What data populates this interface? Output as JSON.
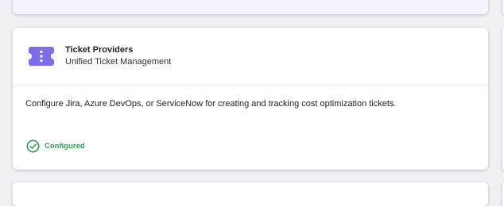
{
  "card": {
    "icon": "ticket-icon",
    "title": "Ticket Providers",
    "subtitle": "Unified Ticket Management",
    "description": "Configure Jira, Azure DevOps, or ServiceNow for creating and tracking cost optimization tickets.",
    "status": {
      "icon": "check-circle-icon",
      "label": "Configured"
    }
  },
  "colors": {
    "icon_accent": "#7b6ee8",
    "status_green": "#2e9d58",
    "top_card_tint": "#f4f2fd"
  }
}
